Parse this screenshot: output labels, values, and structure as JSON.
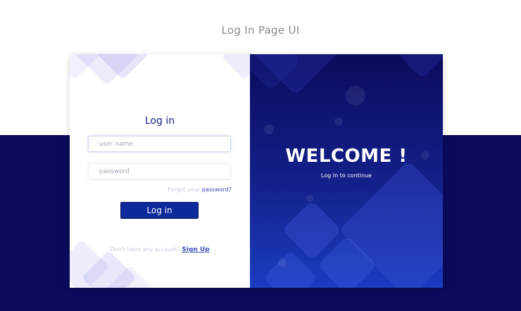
{
  "page": {
    "title": "Log In Page UI"
  },
  "login_form": {
    "heading": "Log in",
    "username_placeholder": "user name",
    "password_placeholder": "password",
    "forgot_prefix": "Forgot your ",
    "forgot_link": "password?",
    "submit_label": "Log in",
    "signup_prefix": "Don't have any account? ",
    "signup_link": "Sign Up"
  },
  "welcome_panel": {
    "heading": "WELCOME !",
    "subtitle": "Log In to continue"
  },
  "colors": {
    "dark_navy": "#0b0a5c",
    "primary_button": "#0d2a9c",
    "accent_text": "#1a237e",
    "link": "#3949ab"
  }
}
